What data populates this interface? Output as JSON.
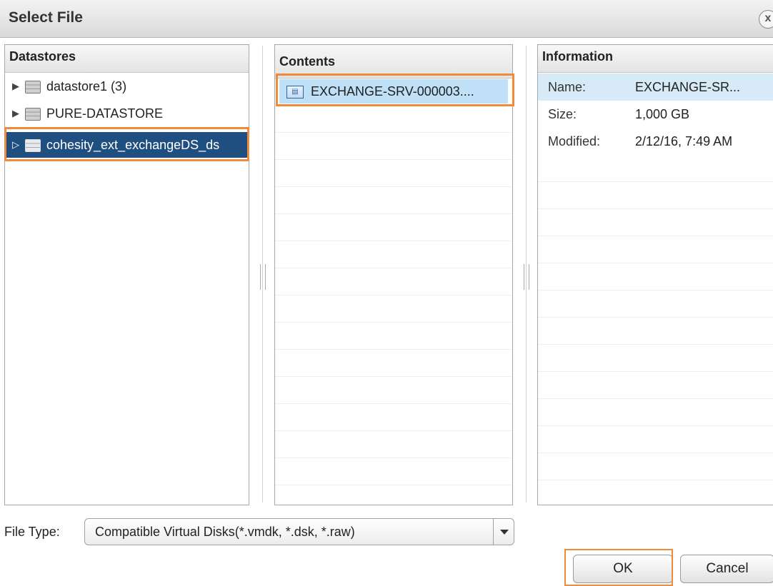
{
  "dialog": {
    "title": "Select File",
    "close_label": "x"
  },
  "datastores": {
    "header": "Datastores",
    "items": [
      {
        "label": "datastore1 (3)",
        "selected": false
      },
      {
        "label": "PURE-DATASTORE",
        "selected": false
      },
      {
        "label": "cohesity_ext_exchangeDS_ds",
        "selected": true
      }
    ]
  },
  "contents": {
    "header": "Contents",
    "items": [
      {
        "label": "EXCHANGE-SRV-000003....",
        "icon": "virtual-disk-icon"
      }
    ]
  },
  "information": {
    "header": "Information",
    "rows": [
      {
        "key": "Name:",
        "value": "EXCHANGE-SR..."
      },
      {
        "key": "Size:",
        "value": "1,000 GB"
      },
      {
        "key": "Modified:",
        "value": "2/12/16, 7:49 AM"
      }
    ]
  },
  "file_type": {
    "label": "File Type:",
    "selected": "Compatible Virtual Disks(*.vmdk, *.dsk, *.raw)"
  },
  "buttons": {
    "ok": "OK",
    "cancel": "Cancel"
  },
  "colors": {
    "highlight": "#ef8b3a",
    "selected_tree": "#1f4f80",
    "selected_content": "#bfe0f7"
  }
}
